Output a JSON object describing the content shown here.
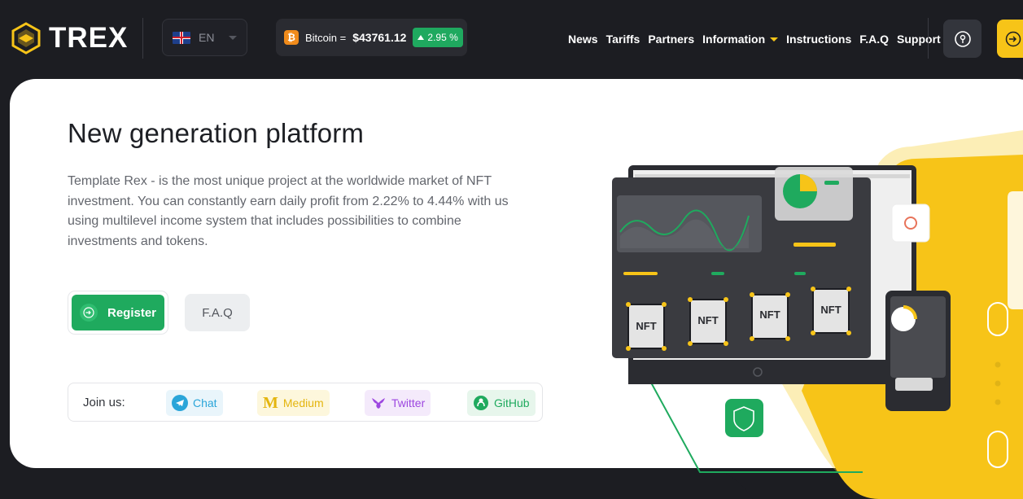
{
  "brand": {
    "name": "TREX"
  },
  "language": {
    "code": "EN"
  },
  "ticker": {
    "label": "Bitcoin =",
    "price": "$43761.12",
    "change": "2.95 %",
    "coin_symbol": "₿"
  },
  "nav": {
    "items": [
      "News",
      "Tariffs",
      "Partners",
      "Information",
      "Instructions",
      "F.A.Q",
      "Support"
    ]
  },
  "header_icons": {
    "left": "location-pin-icon",
    "right": "login-icon"
  },
  "hero": {
    "title": "New generation platform",
    "description": "Template Rex - is the most unique project at the worldwide market of NFT investment. You can constantly earn daily profit from 2.22% to 4.44% with us using multilevel income system that includes possibilities to combine investments and tokens.",
    "register_label": "Register",
    "faq_label": "F.A.Q"
  },
  "join": {
    "label": "Join us:",
    "links": [
      {
        "label": "Chat",
        "icon": "telegram-icon",
        "color": "#2aa5d9"
      },
      {
        "label": "Medium",
        "icon": "medium-icon",
        "color": "#e4b50e"
      },
      {
        "label": "Twitter",
        "icon": "twitter-icon",
        "color": "#9d47e0"
      },
      {
        "label": "GitHub",
        "icon": "github-icon",
        "color": "#1faa5e"
      }
    ]
  },
  "illustration": {
    "card_labels": [
      "NFT",
      "NFT",
      "NFT",
      "NFT"
    ]
  },
  "colors": {
    "accent_green": "#1faa5e",
    "accent_yellow": "#f7c418",
    "bg_dark": "#1c1d22"
  }
}
